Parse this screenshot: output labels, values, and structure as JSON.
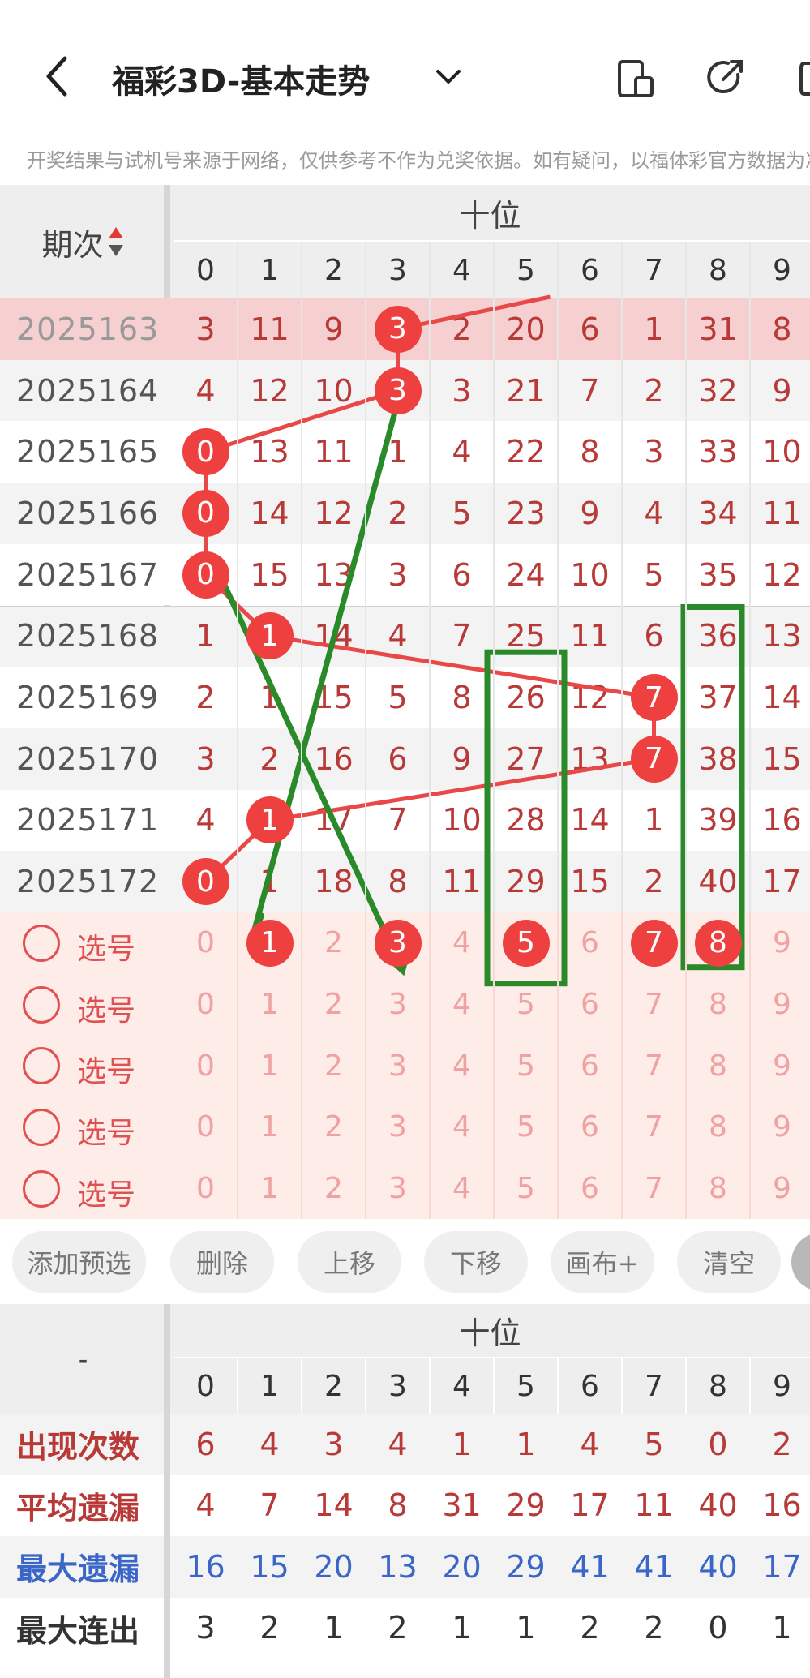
{
  "header": {
    "title": "福彩3D-基本走势",
    "notice": "开奖结果与试机号来源于网络，仅供参考不作为兑奖依据。如有疑问，以福体彩官方数据为准"
  },
  "trend_table": {
    "period_header": "期次",
    "group_header": "十位",
    "digits": [
      "0",
      "1",
      "2",
      "3",
      "4",
      "5",
      "6",
      "7",
      "8",
      "9"
    ],
    "rows": [
      {
        "issue": "2025163",
        "cells": [
          "3",
          "11",
          "9",
          "3",
          "2",
          "20",
          "6",
          "1",
          "31",
          "8"
        ],
        "hit": 3
      },
      {
        "issue": "2025164",
        "cells": [
          "4",
          "12",
          "10",
          "3",
          "3",
          "21",
          "7",
          "2",
          "32",
          "9"
        ],
        "hit": 3
      },
      {
        "issue": "2025165",
        "cells": [
          "0",
          "13",
          "11",
          "1",
          "4",
          "22",
          "8",
          "3",
          "33",
          "10"
        ],
        "hit": 0
      },
      {
        "issue": "2025166",
        "cells": [
          "0",
          "14",
          "12",
          "2",
          "5",
          "23",
          "9",
          "4",
          "34",
          "11"
        ],
        "hit": 0
      },
      {
        "issue": "2025167",
        "cells": [
          "0",
          "15",
          "13",
          "3",
          "6",
          "24",
          "10",
          "5",
          "35",
          "12"
        ],
        "hit": 0
      },
      {
        "issue": "2025168",
        "cells": [
          "1",
          "1",
          "14",
          "4",
          "7",
          "25",
          "11",
          "6",
          "36",
          "13"
        ],
        "hit": 1
      },
      {
        "issue": "2025169",
        "cells": [
          "2",
          "1",
          "15",
          "5",
          "8",
          "26",
          "12",
          "7",
          "37",
          "14"
        ],
        "hit": 7
      },
      {
        "issue": "2025170",
        "cells": [
          "3",
          "2",
          "16",
          "6",
          "9",
          "27",
          "13",
          "7",
          "38",
          "15"
        ],
        "hit": 7
      },
      {
        "issue": "2025171",
        "cells": [
          "4",
          "1",
          "17",
          "7",
          "10",
          "28",
          "14",
          "1",
          "39",
          "16"
        ],
        "hit": 1
      },
      {
        "issue": "2025172",
        "cells": [
          "0",
          "1",
          "18",
          "8",
          "11",
          "29",
          "15",
          "2",
          "40",
          "17"
        ],
        "hit": 0
      }
    ],
    "pick_label": "选号",
    "pick_rows": [
      {
        "selected": [
          1,
          3,
          5,
          7,
          8
        ]
      },
      {
        "selected": []
      },
      {
        "selected": []
      },
      {
        "selected": []
      },
      {
        "selected": []
      }
    ]
  },
  "buttons": [
    "添加预选",
    "删除",
    "上移",
    "下移",
    "画布+",
    "清空"
  ],
  "stats_table": {
    "corner": "-",
    "group_header": "十位",
    "digits": [
      "0",
      "1",
      "2",
      "3",
      "4",
      "5",
      "6",
      "7",
      "8",
      "9"
    ],
    "rows": [
      {
        "label": "出现次数",
        "values": [
          "6",
          "4",
          "3",
          "4",
          "1",
          "1",
          "4",
          "5",
          "0",
          "2"
        ],
        "color": "#b83a38"
      },
      {
        "label": "平均遗漏",
        "values": [
          "4",
          "7",
          "14",
          "8",
          "31",
          "29",
          "17",
          "11",
          "40",
          "16"
        ],
        "color": "#b83a38"
      },
      {
        "label": "最大遗漏",
        "values": [
          "16",
          "15",
          "20",
          "13",
          "20",
          "29",
          "41",
          "41",
          "40",
          "17"
        ],
        "color": "#3a66c8"
      },
      {
        "label": "最大连出",
        "values": [
          "3",
          "2",
          "1",
          "2",
          "1",
          "1",
          "2",
          "2",
          "0",
          "1"
        ],
        "color": "#333333"
      }
    ]
  },
  "colors": {
    "accent_red": "#ef4040",
    "annotation_green": "#2a8a2a",
    "highlight_row": "#f4c9c9",
    "pick_bg": "#fdece8"
  },
  "icons": [
    "back-arrow-icon",
    "chevron-down-icon",
    "device-icon",
    "share-icon",
    "more-icon",
    "sort-arrows-icon"
  ]
}
